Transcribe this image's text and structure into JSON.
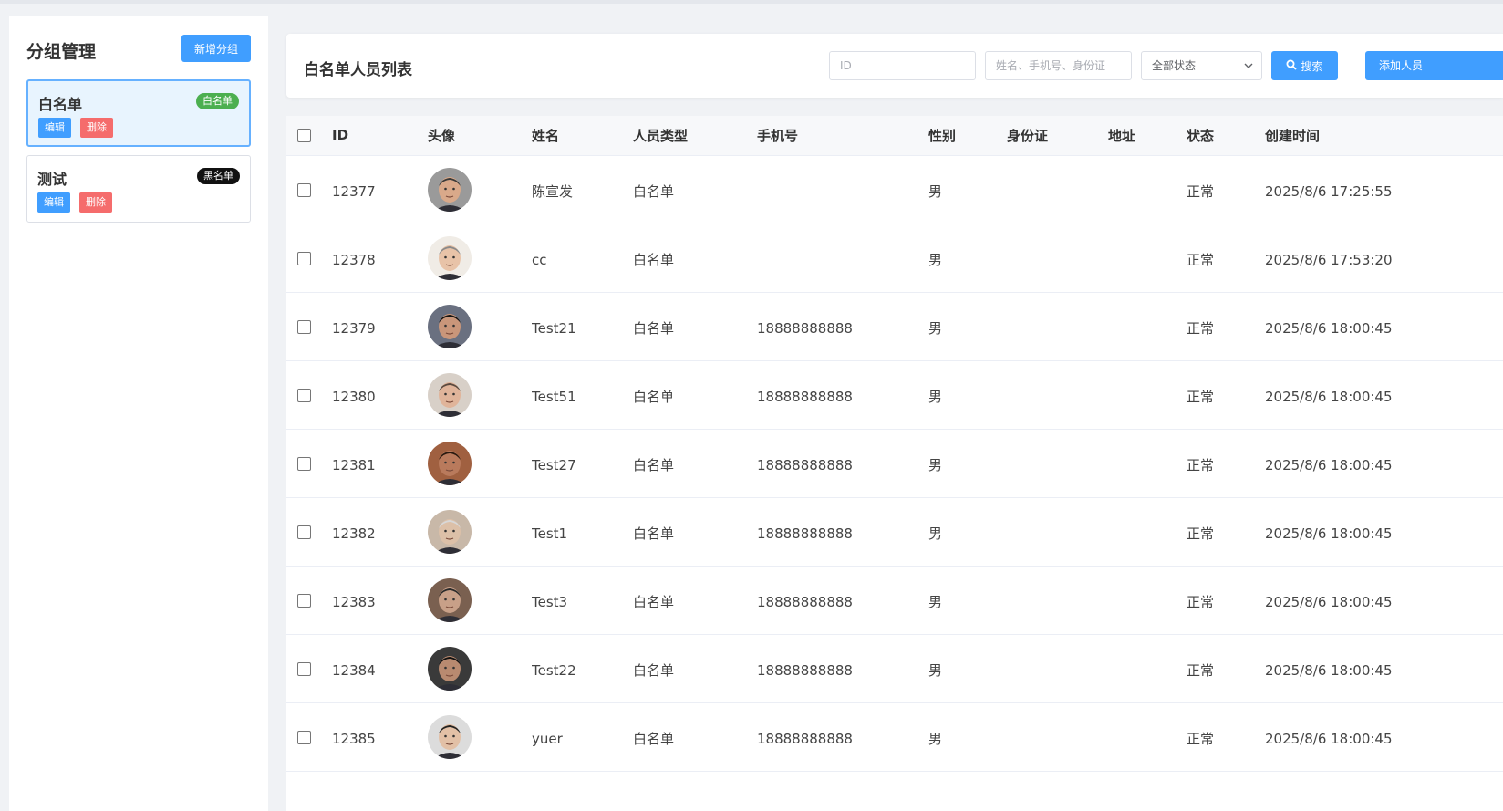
{
  "sidebar": {
    "title": "分组管理",
    "add_group_label": "新增分组",
    "groups": [
      {
        "name": "白名单",
        "tag": "白名单",
        "edit_label": "编辑",
        "delete_label": "删除"
      },
      {
        "name": "测试",
        "tag": "黑名单",
        "edit_label": "编辑",
        "delete_label": "删除"
      }
    ]
  },
  "header": {
    "title": "白名单人员列表",
    "id_placeholder": "ID",
    "keyword_placeholder": "姓名、手机号、身份证",
    "status_selected": "全部状态",
    "search_label": "搜索",
    "add_person_label": "添加人员"
  },
  "table": {
    "columns": [
      "ID",
      "头像",
      "姓名",
      "人员类型",
      "手机号",
      "性别",
      "身份证",
      "地址",
      "状态",
      "创建时间"
    ],
    "rows": [
      {
        "id": "12377",
        "name": "陈宣发",
        "type": "白名单",
        "phone": "",
        "gender": "男",
        "idcard": "",
        "address": "",
        "status": "正常",
        "created": "2025/8/6 17:25:55"
      },
      {
        "id": "12378",
        "name": "cc",
        "type": "白名单",
        "phone": "",
        "gender": "男",
        "idcard": "",
        "address": "",
        "status": "正常",
        "created": "2025/8/6 17:53:20"
      },
      {
        "id": "12379",
        "name": "Test21",
        "type": "白名单",
        "phone": "18888888888",
        "gender": "男",
        "idcard": "",
        "address": "",
        "status": "正常",
        "created": "2025/8/6 18:00:45"
      },
      {
        "id": "12380",
        "name": "Test51",
        "type": "白名单",
        "phone": "18888888888",
        "gender": "男",
        "idcard": "",
        "address": "",
        "status": "正常",
        "created": "2025/8/6 18:00:45"
      },
      {
        "id": "12381",
        "name": "Test27",
        "type": "白名单",
        "phone": "18888888888",
        "gender": "男",
        "idcard": "",
        "address": "",
        "status": "正常",
        "created": "2025/8/6 18:00:45"
      },
      {
        "id": "12382",
        "name": "Test1",
        "type": "白名单",
        "phone": "18888888888",
        "gender": "男",
        "idcard": "",
        "address": "",
        "status": "正常",
        "created": "2025/8/6 18:00:45"
      },
      {
        "id": "12383",
        "name": "Test3",
        "type": "白名单",
        "phone": "18888888888",
        "gender": "男",
        "idcard": "",
        "address": "",
        "status": "正常",
        "created": "2025/8/6 18:00:45"
      },
      {
        "id": "12384",
        "name": "Test22",
        "type": "白名单",
        "phone": "18888888888",
        "gender": "男",
        "idcard": "",
        "address": "",
        "status": "正常",
        "created": "2025/8/6 18:00:45"
      },
      {
        "id": "12385",
        "name": "yuer",
        "type": "白名单",
        "phone": "18888888888",
        "gender": "男",
        "idcard": "",
        "address": "",
        "status": "正常",
        "created": "2025/8/6 18:00:45"
      }
    ]
  },
  "colors": {
    "primary": "#409eff",
    "danger": "#f56c6c",
    "success_tag": "#4caf50",
    "black_tag": "#111111"
  }
}
